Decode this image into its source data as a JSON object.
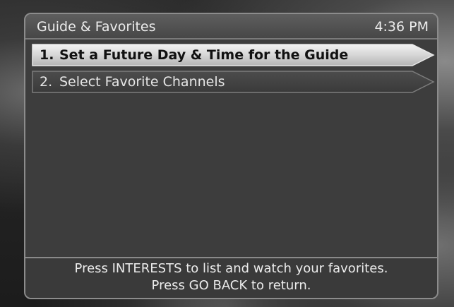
{
  "header": {
    "title": "Guide & Favorites",
    "time": "4:36 PM"
  },
  "menu": {
    "items": [
      {
        "number": "1.",
        "label": "Set a Future Day & Time for the Guide",
        "selected": true
      },
      {
        "number": "2.",
        "label": "Select Favorite Channels",
        "selected": false
      }
    ]
  },
  "footer": {
    "line1": "Press INTERESTS to list and watch your favorites.",
    "line2": "Press GO BACK to return."
  }
}
